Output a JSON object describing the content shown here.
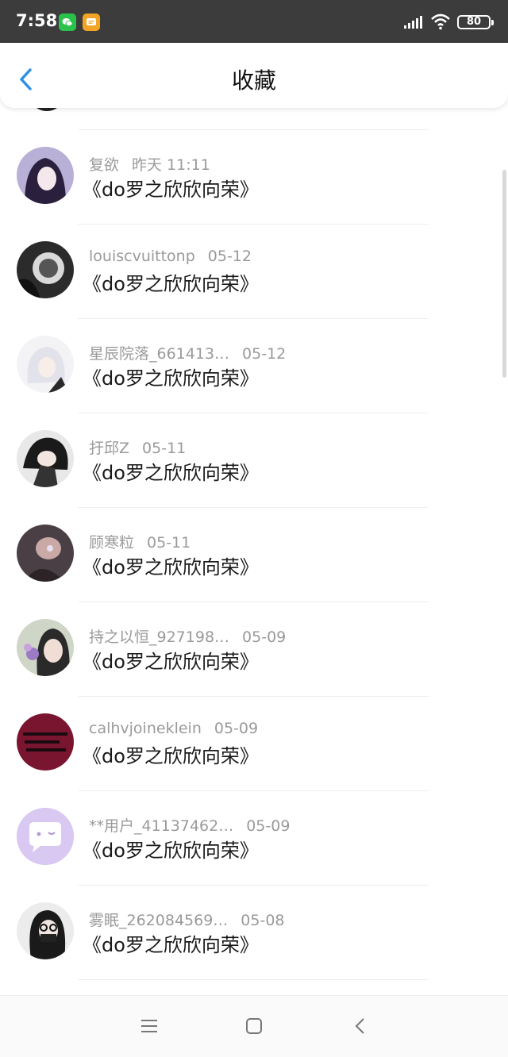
{
  "status_bar": {
    "time": "7:58",
    "battery": "80"
  },
  "header": {
    "title": "收藏"
  },
  "colors": {
    "accent": "#2b8fe6",
    "status_bg": "#3c3c3c"
  },
  "items": [
    {
      "name": "复欲",
      "time": "昨天 11:11",
      "content": "《do罗之欣欣向荣》"
    },
    {
      "name": "louiscvuittonp",
      "time": "05-12",
      "content": "《do罗之欣欣向荣》"
    },
    {
      "name": "星辰院落_661413…",
      "time": "05-12",
      "content": "《do罗之欣欣向荣》"
    },
    {
      "name": "扜邱Z",
      "time": "05-11",
      "content": "《do罗之欣欣向荣》"
    },
    {
      "name": "顾寒粒",
      "time": "05-11",
      "content": "《do罗之欣欣向荣》"
    },
    {
      "name": "持之以恒_927198…",
      "time": "05-09",
      "content": "《do罗之欣欣向荣》"
    },
    {
      "name": "calhvjoineklein",
      "time": "05-09",
      "content": "《do罗之欣欣向荣》"
    },
    {
      "name": "**用户_41137462…",
      "time": "05-09",
      "content": "《do罗之欣欣向荣》"
    },
    {
      "name": "雾眠_262084569…",
      "time": "05-08",
      "content": "《do罗之欣欣向荣》"
    }
  ],
  "nav": {
    "icons": [
      "menu-icon",
      "home-square-icon",
      "back-triangle-icon"
    ]
  }
}
